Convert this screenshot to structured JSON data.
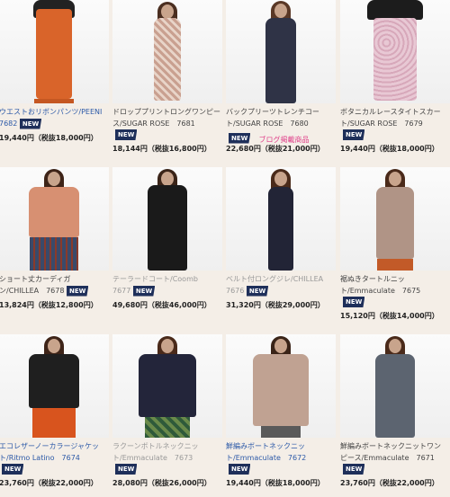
{
  "badge_label": "NEW",
  "promo_text": "ブログ掲載商品",
  "products": [
    {
      "title_line1": "ウエストおリボンパンツ/PEENI",
      "title_line2": "7682",
      "price": "19,440円（税抜18,000円）"
    },
    {
      "title_line1": "ドロッププリントロングワンピー",
      "title_line2": "ス/SUGAR ROSE　7681",
      "price": "18,144円（税抜16,800円）"
    },
    {
      "title_line1": "バックプリーツトレンチコー",
      "title_line2": "ト/SUGAR ROSE　7680",
      "price": "22,680円（税抜21,000円）"
    },
    {
      "title_line1": "ボタニカルレースタイトスカー",
      "title_line2": "ト/SUGAR ROSE　7679",
      "price": "19,440円（税抜18,000円）"
    },
    {
      "title_line1": "ショート丈カーディガ",
      "title_line2": "ン/CHILLEA　7678",
      "price": "13,824円（税抜12,800円）"
    },
    {
      "title_line1": "テーラードコート/Coomb",
      "title_line2": "7677",
      "price": "49,680円（税抜46,000円）"
    },
    {
      "title_line1": "ベルト付ロングジレ/CHILLEA",
      "title_line2": "7676",
      "price": "31,320円（税抜29,000円）"
    },
    {
      "title_line1": "裾ぬきタートルニッ",
      "title_line2": "ト/Emmaculate　7675",
      "price": "15,120円（税抜14,000円）"
    },
    {
      "title_line1": "エコレザーノーカラージャケッ",
      "title_line2": "ト/Ritmo Latino　7674",
      "price": "23,760円（税抜22,000円）"
    },
    {
      "title_line1": "ラクーンボトルネックニッ",
      "title_line2": "ト/Emmaculate　7673",
      "price": "28,080円（税抜26,000円）"
    },
    {
      "title_line1": "鮮編みボートネックニッ",
      "title_line2": "ト/Emmaculate　7672",
      "price": "19,440円（税抜18,000円）"
    },
    {
      "title_line1": "鮮編みボートネックニットワン",
      "title_line2": "ピース/Emmaculate　7671",
      "price": "23,760円（税抜22,000円）"
    }
  ]
}
